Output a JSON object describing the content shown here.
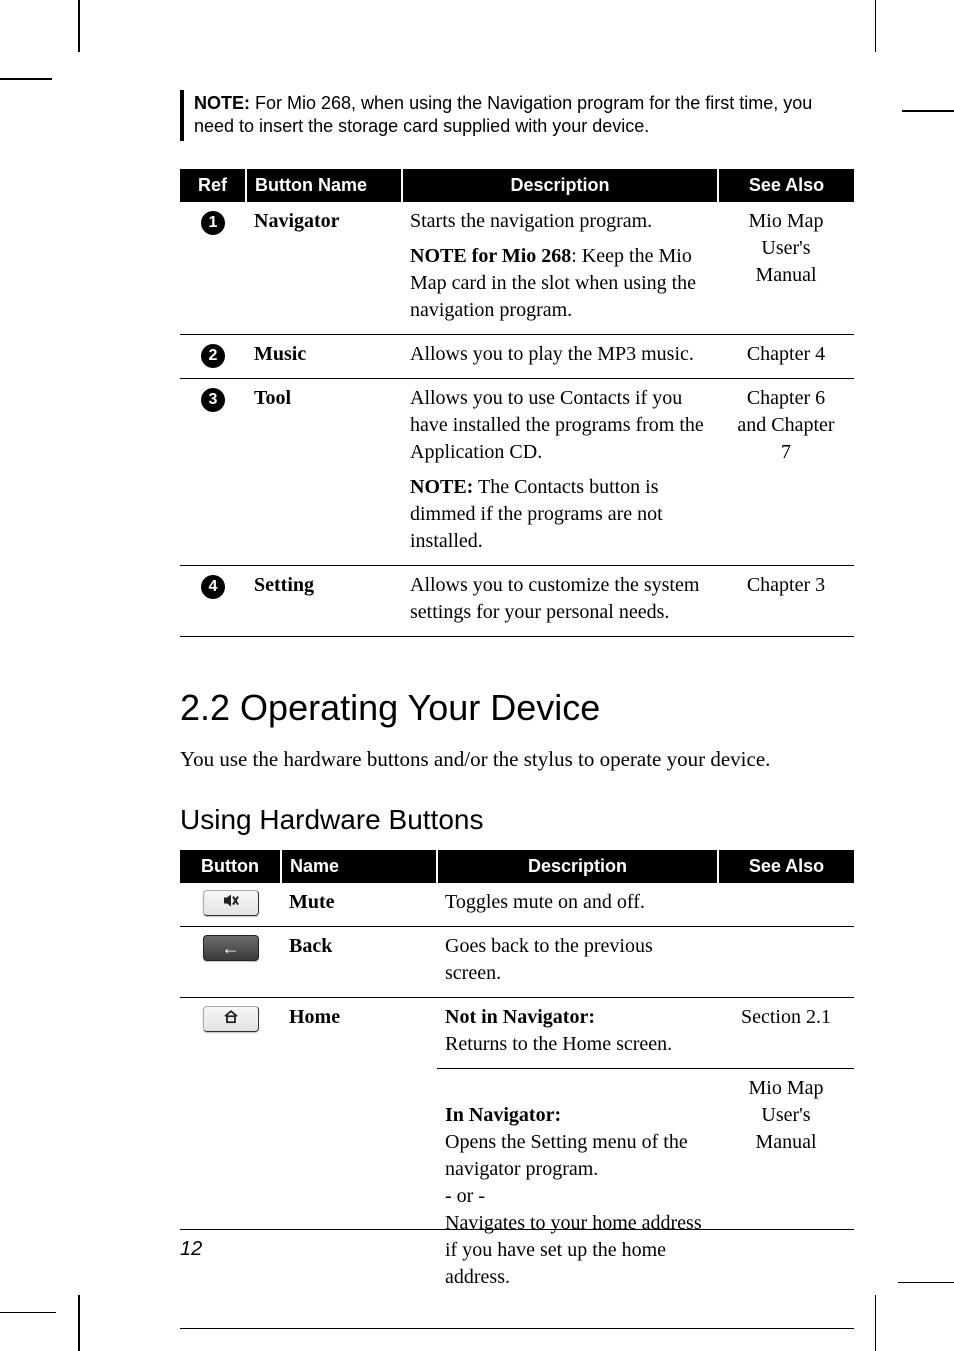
{
  "note": {
    "label": "NOTE:",
    "text": " For Mio 268, when using the Navigation program for the first time, you need to insert the storage card supplied with your device."
  },
  "table1": {
    "headers": {
      "ref": "Ref",
      "name": "Button Name",
      "desc": "Description",
      "see": "See Also"
    },
    "rows": [
      {
        "num": "1",
        "name": "Navigator",
        "see": "Mio Map\nUser's\nManual",
        "desc1": "Starts the navigation program.",
        "desc2_bold": "NOTE for Mio 268",
        "desc2_rest": ": Keep the Mio Map card in the slot when using the navigation program."
      },
      {
        "num": "2",
        "name": "Music",
        "see": "Chapter 4",
        "desc1": "Allows you to play the MP3 music."
      },
      {
        "num": "3",
        "name": "Tool",
        "see": "Chapter 6\nand Chapter\n7",
        "desc1": "Allows you to use Contacts if you have installed the programs from the Application CD.",
        "desc2_bold": "NOTE:",
        "desc2_rest": " The Contacts button is dimmed if the programs are not installed."
      },
      {
        "num": "4",
        "name": "Setting",
        "see": "Chapter 3",
        "desc1": "Allows you to customize the system settings for your personal needs."
      }
    ]
  },
  "section": {
    "title": "2.2   Operating Your Device",
    "intro": "You use the hardware buttons and/or the stylus to operate your device."
  },
  "sub": {
    "title": "Using Hardware Buttons"
  },
  "table2": {
    "headers": {
      "btn": "Button",
      "name": "Name",
      "desc": "Description",
      "see": "See Also"
    },
    "rows": [
      {
        "icon": "mute-icon",
        "name": "Mute",
        "see": "",
        "desc": "Toggles mute on and off."
      },
      {
        "icon": "back-icon",
        "name": "Back",
        "see": "",
        "desc": "Goes back to the previous screen."
      },
      {
        "icon": "home-icon",
        "name": "Home",
        "part_a_title": "Not in Navigator:",
        "part_a_text": "Returns to the Home screen.",
        "part_a_see": "Section 2.1",
        "part_b_title": "In Navigator:",
        "part_b_text": "Opens the Setting menu of the navigator program.\n- or -\nNavigates to your home address if you have set up the home address.",
        "part_b_see": "Mio Map\nUser's\nManual"
      }
    ]
  },
  "page_number": "12"
}
